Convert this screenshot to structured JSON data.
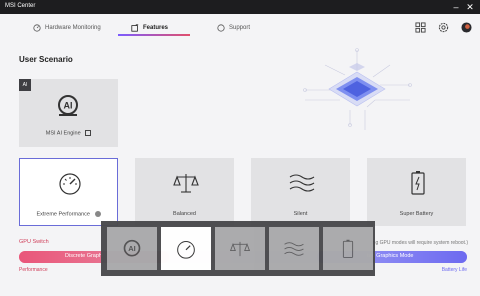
{
  "window": {
    "title": "MSI Center",
    "minimize": "–",
    "close": "✕"
  },
  "nav": {
    "tabs": [
      {
        "label": "Hardware Monitoring"
      },
      {
        "label": "Features"
      },
      {
        "label": "Support"
      }
    ]
  },
  "section_title": "User Scenario",
  "ai_engine": {
    "badge": "AI",
    "label": "MSI AI Engine"
  },
  "scenarios": [
    {
      "label": "Extreme Performance"
    },
    {
      "label": "Balanced"
    },
    {
      "label": "Silent"
    },
    {
      "label": "Super Battery"
    }
  ],
  "gpu": {
    "title": "GPU Switch",
    "discrete": "Discrete Graphi",
    "integrated": "ted Graphics Mode",
    "note": "ing GPU modes will require system reboot.)",
    "left_label": "Performance",
    "right_label": "Battery Life"
  },
  "colors": {
    "accent": "#d0405b",
    "purple": "#6d6af0",
    "selected_border": "#6a6cd8"
  }
}
